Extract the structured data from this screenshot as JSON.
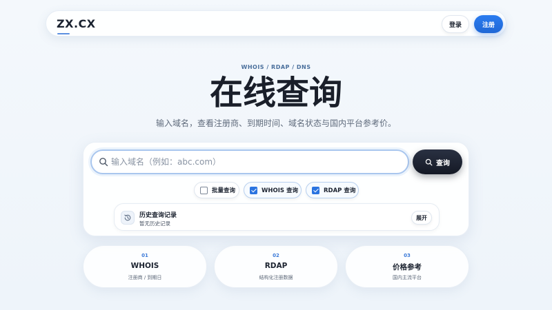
{
  "nav": {
    "logo": "ZX.CX",
    "login_label": "登录",
    "register_label": "注册"
  },
  "hero": {
    "eyebrow": "WHOIS / RDAP / DNS",
    "title": "在线查询",
    "subtitle": "输入域名，查看注册商、到期时间、域名状态与国内平台参考价。"
  },
  "search": {
    "placeholder": "输入域名（例如：abc.com）",
    "value": "",
    "button_label": "查询",
    "icon": "search-icon"
  },
  "options": [
    {
      "label": "批量查询",
      "checked": false
    },
    {
      "label": "WHOIS 查询",
      "checked": true
    },
    {
      "label": "RDAP 查询",
      "checked": true
    }
  ],
  "history": {
    "icon": "history-icon",
    "title": "历史查询记录",
    "empty_text": "暂无历史记录",
    "expand_label": "展开"
  },
  "features": [
    {
      "num": "01",
      "title": "WHOIS",
      "desc": "注册商 / 到期日"
    },
    {
      "num": "02",
      "title": "RDAP",
      "desc": "结构化注册数据"
    },
    {
      "num": "03",
      "title": "价格参考",
      "desc": "国内主流平台"
    }
  ],
  "colors": {
    "accent": "#1f67d6",
    "dark_button": "#1a2030",
    "background": "#f1f6fb"
  }
}
